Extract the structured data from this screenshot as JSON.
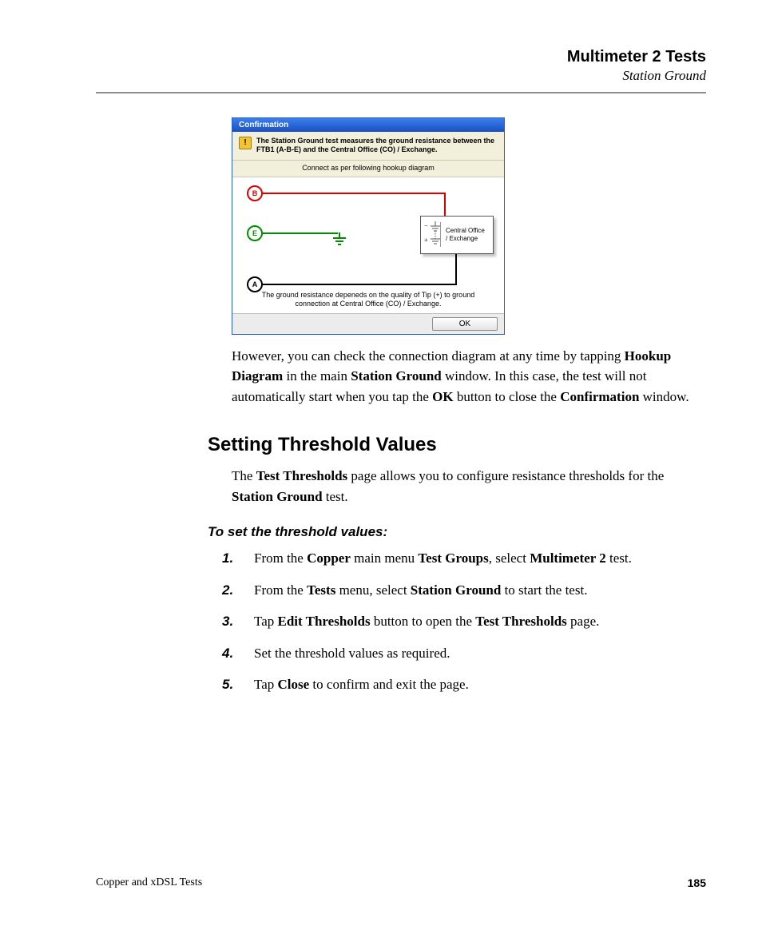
{
  "header": {
    "chapter": "Multimeter 2 Tests",
    "section": "Station Ground"
  },
  "dialog": {
    "title": "Confirmation",
    "warn_glyph": "!",
    "message": "The Station Ground test measures the ground resistance between the FTB1 (A-B-E) and the Central Office (CO) / Exchange.",
    "caption": "Connect as per following hookup diagram",
    "nodes": {
      "b": "B",
      "e": "E",
      "a": "A"
    },
    "co_minus": "−",
    "co_plus": "+",
    "co_label": "Central Office / Exchange",
    "note2": "The ground resistance depeneds on the quality of Tip (+) to ground connection at Central Office (CO) / Exchange.",
    "ok": "OK"
  },
  "para1": {
    "t1": "However, you can check the connection diagram at any time by tapping ",
    "b1": "Hookup Diagram",
    "t2": " in the main ",
    "b2": "Station Ground",
    "t3": " window. In this case, the test will not automatically start when you tap the ",
    "b3": "OK",
    "t4": " button to close the ",
    "b4": "Confirmation",
    "t5": " window."
  },
  "h2": "Setting Threshold Values",
  "para2": {
    "t1": "The ",
    "b1": "Test Thresholds",
    "t2": " page allows you to configure resistance thresholds for the ",
    "b2": "Station Ground",
    "t3": " test."
  },
  "proc_head": "To set the threshold values:",
  "steps": [
    {
      "t1": "From the ",
      "b1": "Copper",
      "t2": " main menu ",
      "b2": "Test Groups",
      "t3": ", select ",
      "b3": "Multimeter 2",
      "t4": " test."
    },
    {
      "t1": "From the ",
      "b1": "Tests",
      "t2": " menu, select ",
      "b2": "Station Ground",
      "t3": " to start the test.",
      "b3": "",
      "t4": ""
    },
    {
      "t1": "Tap ",
      "b1": "Edit Thresholds",
      "t2": " button to open the ",
      "b2": "Test Thresholds",
      "t3": " page.",
      "b3": "",
      "t4": ""
    },
    {
      "t1": "Set the threshold values as required.",
      "b1": "",
      "t2": "",
      "b2": "",
      "t3": "",
      "b3": "",
      "t4": ""
    },
    {
      "t1": "Tap ",
      "b1": "Close",
      "t2": " to confirm and exit the page.",
      "b2": "",
      "t3": "",
      "b3": "",
      "t4": ""
    }
  ],
  "footer": {
    "left": "Copper and xDSL Tests",
    "page": "185"
  }
}
